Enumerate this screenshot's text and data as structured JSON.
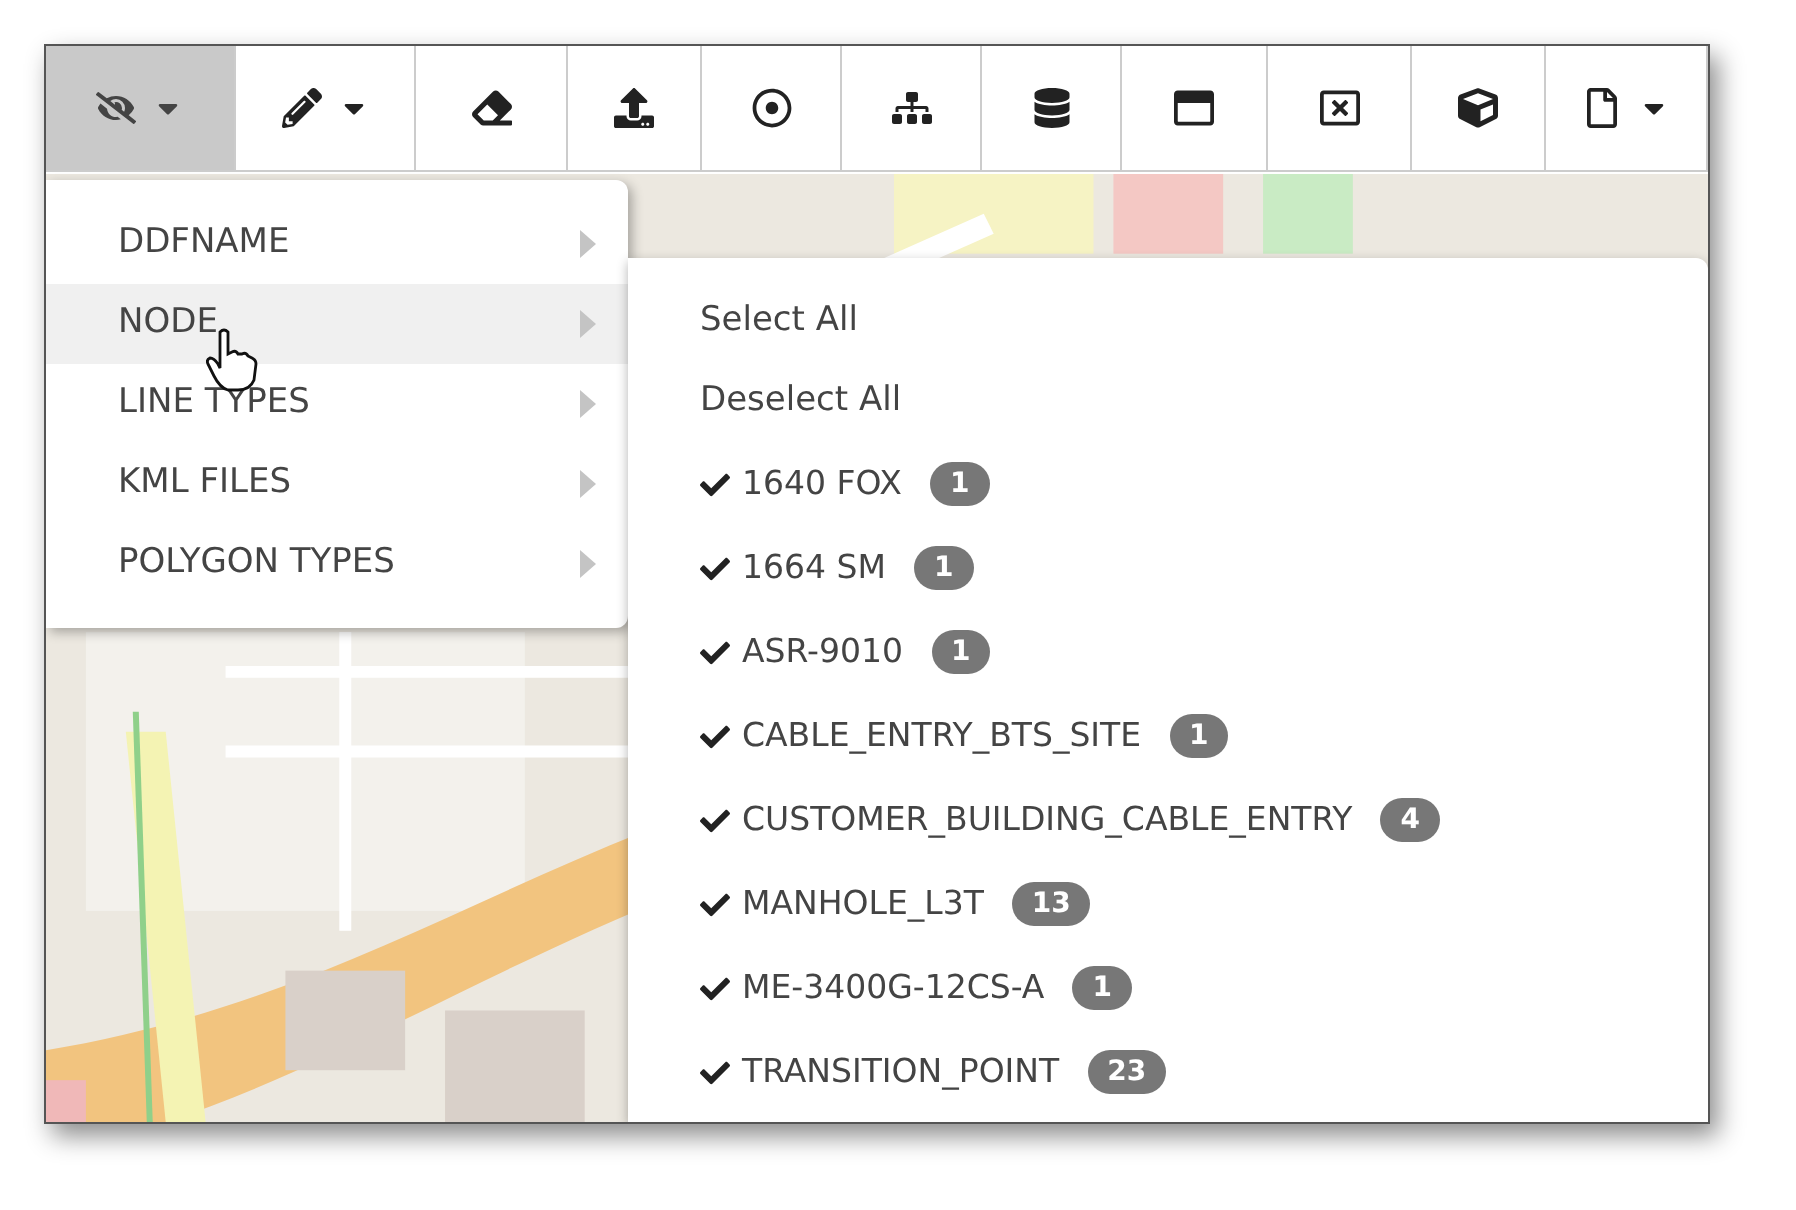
{
  "toolbar": {
    "buttons": [
      {
        "selected": true,
        "dropdown": true
      },
      {
        "selected": false,
        "dropdown": true
      },
      {
        "selected": false,
        "dropdown": false
      },
      {
        "selected": false,
        "dropdown": false
      },
      {
        "selected": false,
        "dropdown": false
      },
      {
        "selected": false,
        "dropdown": false
      },
      {
        "selected": false,
        "dropdown": false
      },
      {
        "selected": false,
        "dropdown": false
      },
      {
        "selected": false,
        "dropdown": false
      },
      {
        "selected": false,
        "dropdown": false
      },
      {
        "selected": false,
        "dropdown": true
      }
    ]
  },
  "menu": {
    "items": [
      {
        "label": "DDFNAME",
        "selected": false
      },
      {
        "label": "NODE",
        "selected": true
      },
      {
        "label": "LINE TYPES",
        "selected": false
      },
      {
        "label": "KML FILES",
        "selected": false
      },
      {
        "label": "POLYGON TYPES",
        "selected": false
      }
    ]
  },
  "submenu": {
    "actions": [
      "Select All",
      "Deselect All"
    ],
    "items": [
      {
        "label": "1640 FOX",
        "checked": true,
        "count": "1"
      },
      {
        "label": "1664 SM",
        "checked": true,
        "count": "1"
      },
      {
        "label": "ASR-9010",
        "checked": true,
        "count": "1"
      },
      {
        "label": "CABLE_ENTRY_BTS_SITE",
        "checked": true,
        "count": "1"
      },
      {
        "label": "CUSTOMER_BUILDING_CABLE_ENTRY",
        "checked": true,
        "count": "4"
      },
      {
        "label": "MANHOLE_L3T",
        "checked": true,
        "count": "13"
      },
      {
        "label": "ME-3400G-12CS-A",
        "checked": true,
        "count": "1"
      },
      {
        "label": "TRANSITION_POINT",
        "checked": true,
        "count": "23"
      }
    ]
  }
}
